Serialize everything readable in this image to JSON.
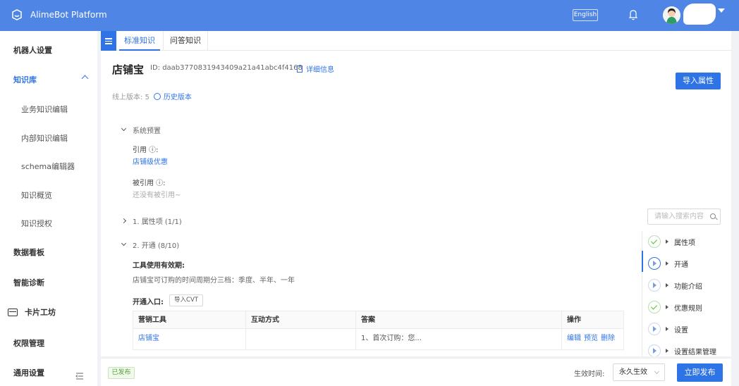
{
  "header": {
    "app_title": "AlimeBot Platform",
    "lang_button": "English",
    "user_name": ""
  },
  "sidebar": {
    "items": [
      {
        "label": "机器人设置"
      },
      {
        "label": "知识库"
      },
      {
        "label": "业务知识编辑"
      },
      {
        "label": "内部知识编辑"
      },
      {
        "label": "schema编辑器"
      },
      {
        "label": "知识概览"
      },
      {
        "label": "知识授权"
      },
      {
        "label": "数据看板"
      },
      {
        "label": "智能诊断"
      },
      {
        "label": "卡片工坊"
      },
      {
        "label": "权限管理"
      },
      {
        "label": "通用设置"
      }
    ]
  },
  "tabs": [
    {
      "label": "标准知识"
    },
    {
      "label": "问答知识"
    }
  ],
  "knowledge": {
    "title": "店铺宝",
    "id_text": "ID: daab3770831943409a21a41abc4f4168",
    "detail_link": "详细信息",
    "import_button": "导入属性",
    "version_label": "线上版本: 5",
    "history_link": "历史版本"
  },
  "sections": {
    "system": "系统预置",
    "ref_label": "引用 ⓘ:",
    "ref_value": "店铺级优惠",
    "refby_label": "被引用 ⓘ:",
    "refby_value": "还没有被引用~",
    "attr": "1. 属性项 (1/1)",
    "open": "2. 开通 (8/10)",
    "tool_label": "工具使用有效期:",
    "tool_desc": "店铺宝可订购的时间周期分三档：季度、半年、一年",
    "entry_label": "开通入口:",
    "cvt_button": "导入CVT"
  },
  "search": {
    "placeholder": "请输入搜索内容"
  },
  "table": {
    "headers": [
      "营销工具",
      "互动方式",
      "答案",
      "操作"
    ],
    "rows": [
      {
        "tool": "店铺宝",
        "mode": "",
        "answer": "1、首次订购：您...",
        "ops": [
          "编辑",
          "预览",
          "删除"
        ]
      }
    ]
  },
  "steps": [
    {
      "label": "属性项",
      "state": "done"
    },
    {
      "label": "开通",
      "state": "current"
    },
    {
      "label": "功能介绍",
      "state": "todo"
    },
    {
      "label": "优惠规则",
      "state": "done"
    },
    {
      "label": "设置",
      "state": "todo"
    },
    {
      "label": "设置结果管理",
      "state": "todo"
    }
  ],
  "footer": {
    "status": "已发布",
    "effective_label": "生效时间:",
    "effective_value": "永久生效",
    "publish_button": "立即发布"
  },
  "colors": {
    "topbar": "#4f86e6",
    "accent": "#2f74e6",
    "success": "#52c41a"
  }
}
